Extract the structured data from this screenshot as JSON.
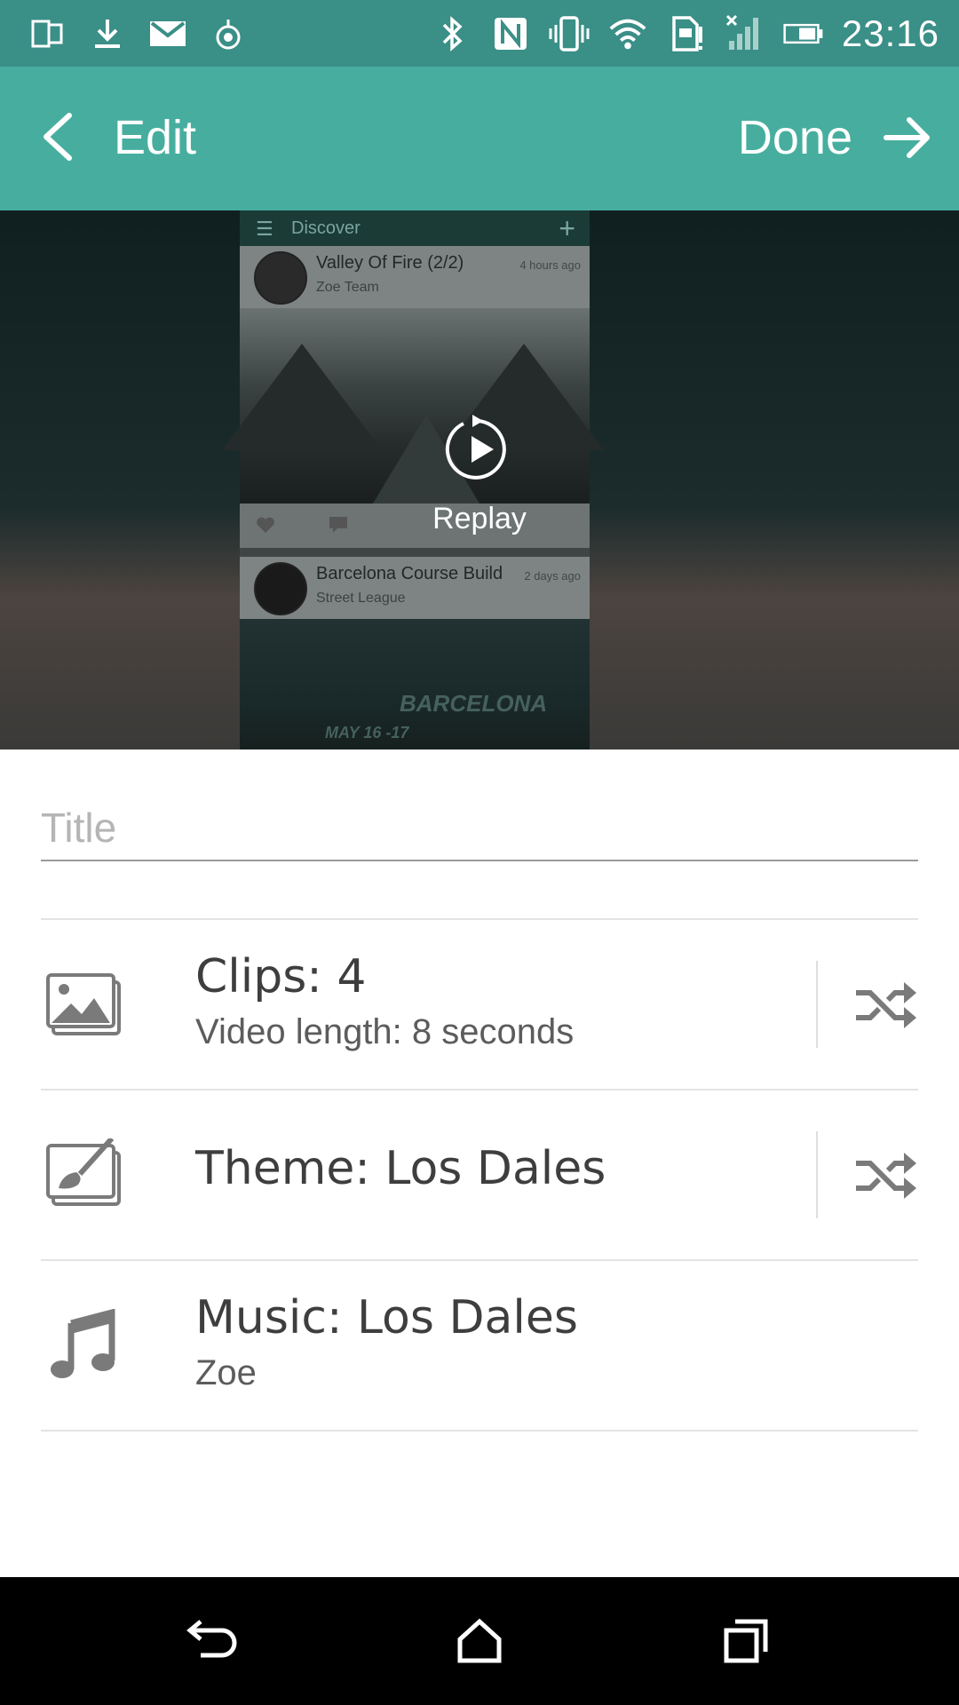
{
  "status_bar": {
    "time": "23:16",
    "left_icons": [
      "screen-mirror-icon",
      "download-icon",
      "gmail-icon",
      "notification-icon"
    ],
    "right_icons": [
      "bluetooth-icon",
      "nfc-icon",
      "vibrate-icon",
      "wifi-icon",
      "sim-icon",
      "signal-icon",
      "battery-icon"
    ]
  },
  "app_bar": {
    "title": "Edit",
    "done_label": "Done",
    "color": "#47ae9f"
  },
  "preview": {
    "replay_label": "Replay",
    "phone": {
      "header_title": "Discover",
      "post1": {
        "name": "Valley Of Fire (2/2)",
        "sub": "Zoe Team",
        "ago": "4 hours ago"
      },
      "post2": {
        "name": "Barcelona Course Build",
        "sub": "Street League",
        "ago": "2 days ago"
      },
      "banner_title": "BARCELONA",
      "banner_date": "MAY 16 -17"
    }
  },
  "form": {
    "title_placeholder": "Title",
    "title_value": ""
  },
  "rows": {
    "clips": {
      "label": "Clips: 4",
      "sub": "Video length: 8 seconds",
      "icon": "image-icon",
      "action_icon": "shuffle-icon"
    },
    "theme": {
      "label": "Theme: Los Dales",
      "icon": "theme-brush-icon",
      "action_icon": "shuffle-icon"
    },
    "music": {
      "label": "Music: Los Dales",
      "sub": "Zoe",
      "icon": "music-note-icon"
    }
  },
  "nav_bar": {
    "buttons": [
      "back-icon",
      "home-icon",
      "recents-icon"
    ]
  }
}
